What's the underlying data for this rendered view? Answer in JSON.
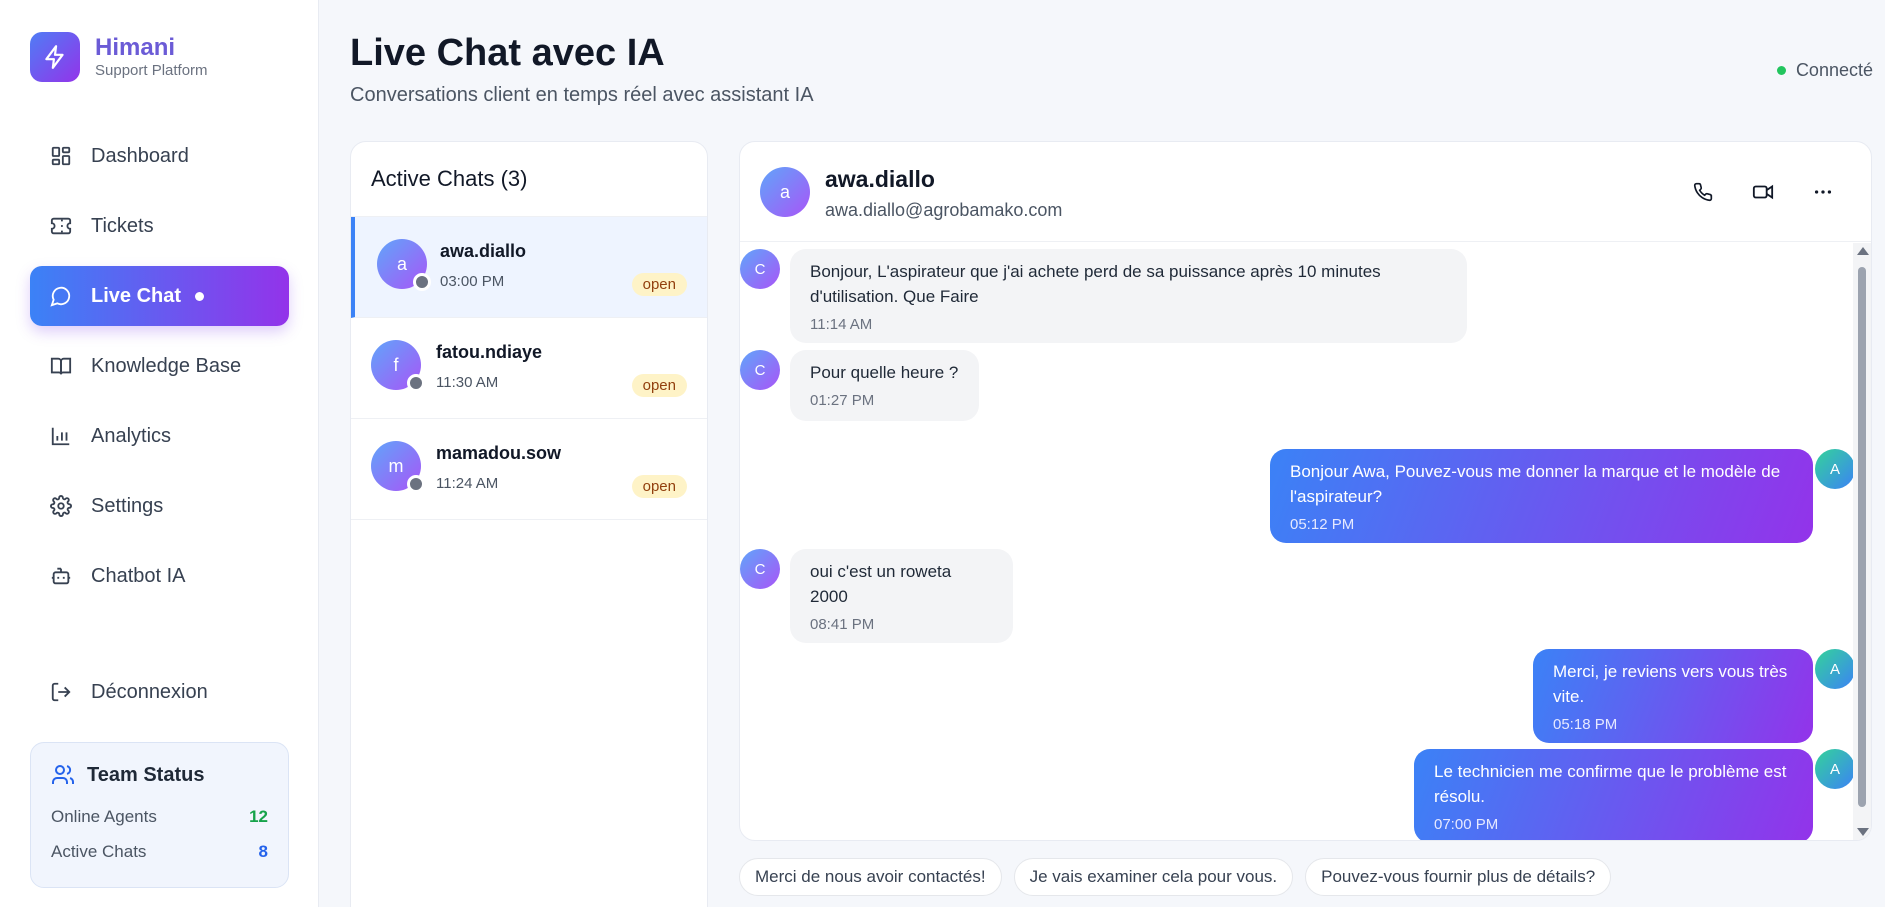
{
  "brand": {
    "name": "Himani",
    "subtitle": "Support Platform"
  },
  "nav": {
    "items": [
      {
        "label": "Dashboard",
        "icon": "dashboard-icon"
      },
      {
        "label": "Tickets",
        "icon": "ticket-icon"
      },
      {
        "label": "Live Chat",
        "icon": "chat-bubble-icon",
        "active": true
      },
      {
        "label": "Knowledge Base",
        "icon": "book-icon"
      },
      {
        "label": "Analytics",
        "icon": "bar-chart-icon"
      },
      {
        "label": "Settings",
        "icon": "gear-icon"
      },
      {
        "label": "Chatbot IA",
        "icon": "bot-icon"
      }
    ],
    "logout_label": "Déconnexion"
  },
  "team_status": {
    "title": "Team Status",
    "online_agents_label": "Online Agents",
    "online_agents_value": "12",
    "active_chats_label": "Active Chats",
    "active_chats_value": "8"
  },
  "header": {
    "title": "Live Chat avec IA",
    "subtitle": "Conversations client en temps réel avec assistant IA",
    "connection_status": "Connecté"
  },
  "chats": {
    "title": "Active Chats (3)",
    "items": [
      {
        "initial": "a",
        "name": "awa.diallo",
        "time": "03:00 PM",
        "status": "open",
        "selected": true
      },
      {
        "initial": "f",
        "name": "fatou.ndiaye",
        "time": "11:30 AM",
        "status": "open"
      },
      {
        "initial": "m",
        "name": "mamadou.sow",
        "time": "11:24 AM",
        "status": "open"
      }
    ]
  },
  "conversation": {
    "initial": "a",
    "name": "awa.diallo",
    "email": "awa.diallo@agrobamako.com",
    "messages": [
      {
        "from": "customer",
        "avatar": "C",
        "text": "Bonjour, L'aspirateur que j'ai achete perd de sa puissance après 10 minutes d'utilisation. Que Faire",
        "time": "11:14 AM"
      },
      {
        "from": "customer",
        "avatar": "C",
        "text": "Pour quelle heure ?",
        "time": "01:27 PM"
      },
      {
        "from": "agent",
        "avatar": "A",
        "text": "Bonjour Awa, Pouvez-vous me donner la marque et le modèle de l'aspirateur?",
        "time": "05:12 PM"
      },
      {
        "from": "customer",
        "avatar": "C",
        "text": "oui c'est un roweta 2000",
        "time": "08:41 PM"
      },
      {
        "from": "agent",
        "avatar": "A",
        "text": "Merci, je reviens vers vous très vite.",
        "time": "05:18 PM"
      },
      {
        "from": "agent",
        "avatar": "A",
        "text": "Le technicien me confirme que le problème est résolu.",
        "time": "07:00 PM"
      }
    ]
  },
  "quick_replies": [
    "Merci de nous avoir contactés!",
    "Je vais examiner cela pour vous.",
    "Pouvez-vous fournir plus de détails?"
  ],
  "colors": {
    "accent_start": "#3b82f6",
    "accent_end": "#9333ea",
    "online": "#22c55e",
    "badge_bg": "#fef3c7"
  }
}
